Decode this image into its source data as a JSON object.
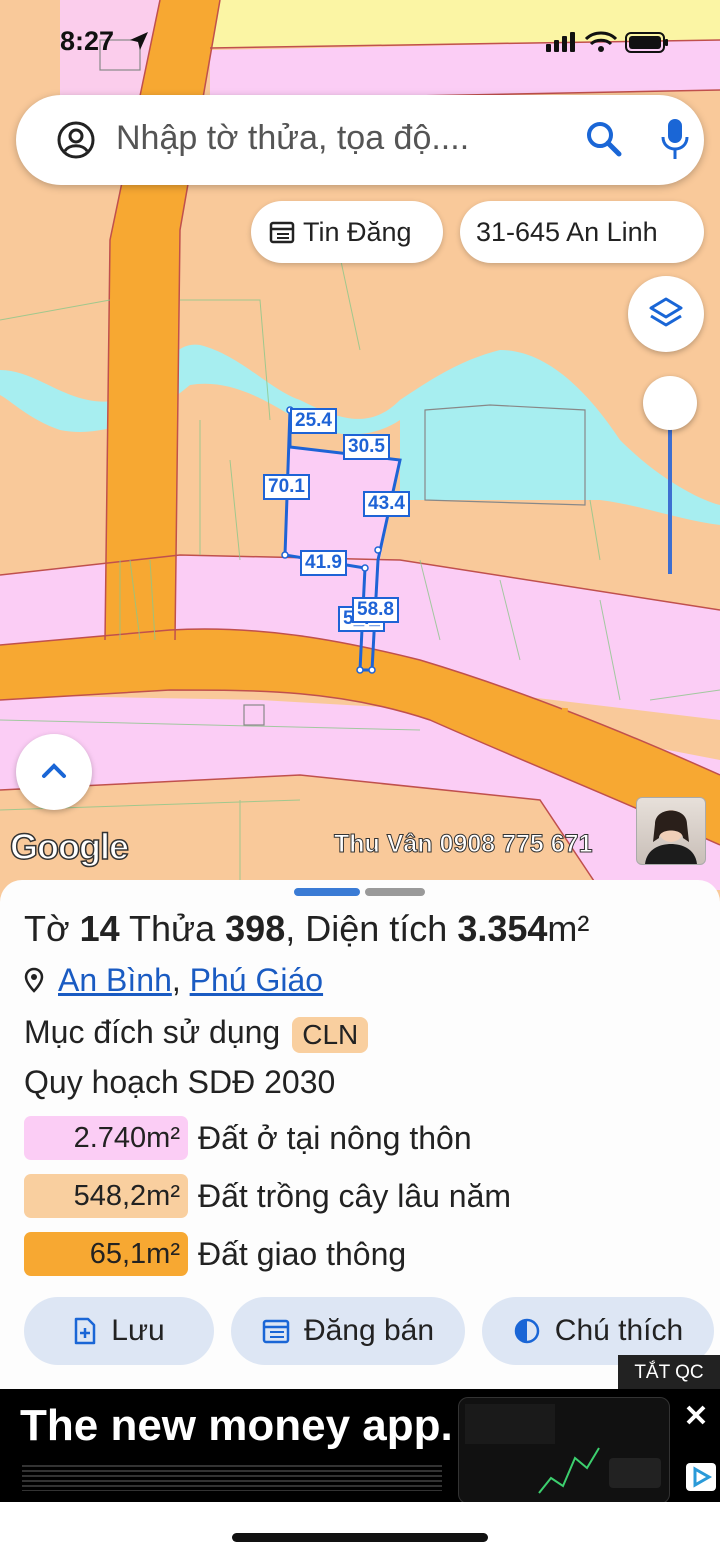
{
  "status_bar": {
    "time": "8:27"
  },
  "search": {
    "placeholder": "Nhập tờ thửa, tọa độ...."
  },
  "chips": {
    "listings": "Tin Đăng",
    "location": "31-645 An Linh"
  },
  "map": {
    "dimensions": [
      "25.4",
      "30.5",
      "70.1",
      "43.4",
      "41.9",
      "58.8",
      "5_._"
    ],
    "google_logo": "Google",
    "watermark": "Thu Vân 0908 775 671"
  },
  "parcel": {
    "title_prefix": "Tờ ",
    "sheet_no": "14",
    "title_mid": " Thửa ",
    "plot_no": "398",
    "title_area_label": ", Diện tích ",
    "area": "3.354",
    "area_unit": "m²",
    "ward": "An Bình",
    "district": "Phú Giáo",
    "purpose_label": "Mục đích sử dụng",
    "purpose_code": "CLN",
    "plan_label": "Quy hoạch SDĐ 2030",
    "zones": [
      {
        "area": "2.740m²",
        "label": "Đất ở tại nông thôn",
        "color": "#fbcdf5"
      },
      {
        "area": "548,2m²",
        "label": "Đất trồng cây lâu năm",
        "color": "#f9cf9f"
      },
      {
        "area": "65,1m²",
        "label": "Đất giao thông",
        "color": "#f7a832"
      }
    ]
  },
  "actions": {
    "save": "Lưu",
    "post": "Đăng bán",
    "legend": "Chú thích"
  },
  "ad": {
    "tag": "TẮT QC",
    "headline": "The new money app."
  },
  "colors": {
    "accent": "#1a5bc2",
    "road": "#f7a832",
    "farm": "#f9cf9f",
    "residential": "#fbcdf5",
    "water": "#a7eef0"
  }
}
